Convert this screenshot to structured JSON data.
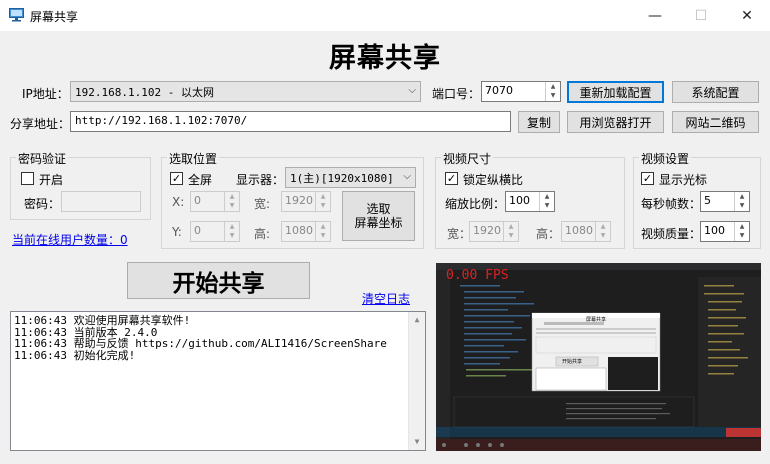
{
  "window": {
    "title": "屏幕共享",
    "minimize": "—",
    "maximize": "☐",
    "close": "✕"
  },
  "heading": "屏幕共享",
  "network": {
    "ip_label": "IP地址：",
    "ip_value": "192.168.1.102 - 以太网",
    "port_label": "端口号：",
    "port_value": "7070",
    "reload_button": "重新加载配置",
    "sysconfig_button": "系统配置",
    "share_label": "分享地址：",
    "share_value": "http://192.168.1.102:7070/",
    "copy_button": "复制",
    "browser_button": "用浏览器打开",
    "qrcode_button": "网站二维码"
  },
  "password_group": {
    "title": "密码验证",
    "enable_label": "开启",
    "enable_checked": false,
    "password_label": "密码：",
    "password_value": ""
  },
  "online_users": "当前在线用户数量：0",
  "region_group": {
    "title": "选取位置",
    "fullscreen_label": "全屏",
    "fullscreen_checked": true,
    "display_label": "显示器：",
    "display_value": "1(主)[1920x1080]",
    "x_label": "X:",
    "x_value": "0",
    "y_label": "Y:",
    "y_value": "0",
    "width_label": "宽:",
    "width_value": "1920",
    "height_label": "高:",
    "height_value": "1080",
    "pick_button_line1": "选取",
    "pick_button_line2": "屏幕坐标"
  },
  "size_group": {
    "title": "视频尺寸",
    "lock_label": "锁定纵横比",
    "lock_checked": true,
    "scale_label": "缩放比例：",
    "scale_value": "100",
    "width_label": "宽：",
    "width_value": "1920",
    "height_label": "高：",
    "height_value": "1080"
  },
  "video_group": {
    "title": "视频设置",
    "cursor_label": "显示光标",
    "cursor_checked": true,
    "fps_label": "每秒帧数：",
    "fps_value": "5",
    "quality_label": "视频质量：",
    "quality_value": "100"
  },
  "start_button": "开始共享",
  "clear_log": "清空日志",
  "log": [
    "11:06:43 欢迎使用屏幕共享软件!",
    "11:06:43 当前版本 2.4.0",
    "11:06:43 帮助与反馈 https://github.com/ALI1416/ScreenShare",
    "11:06:43 初始化完成!"
  ],
  "preview": {
    "fps_text": "0.00 FPS",
    "mini_title": "屏幕共享",
    "mini_button": "开始共享"
  },
  "colors": {
    "accent": "#0078d7",
    "link": "#0000ee",
    "fps": "#e02020"
  }
}
